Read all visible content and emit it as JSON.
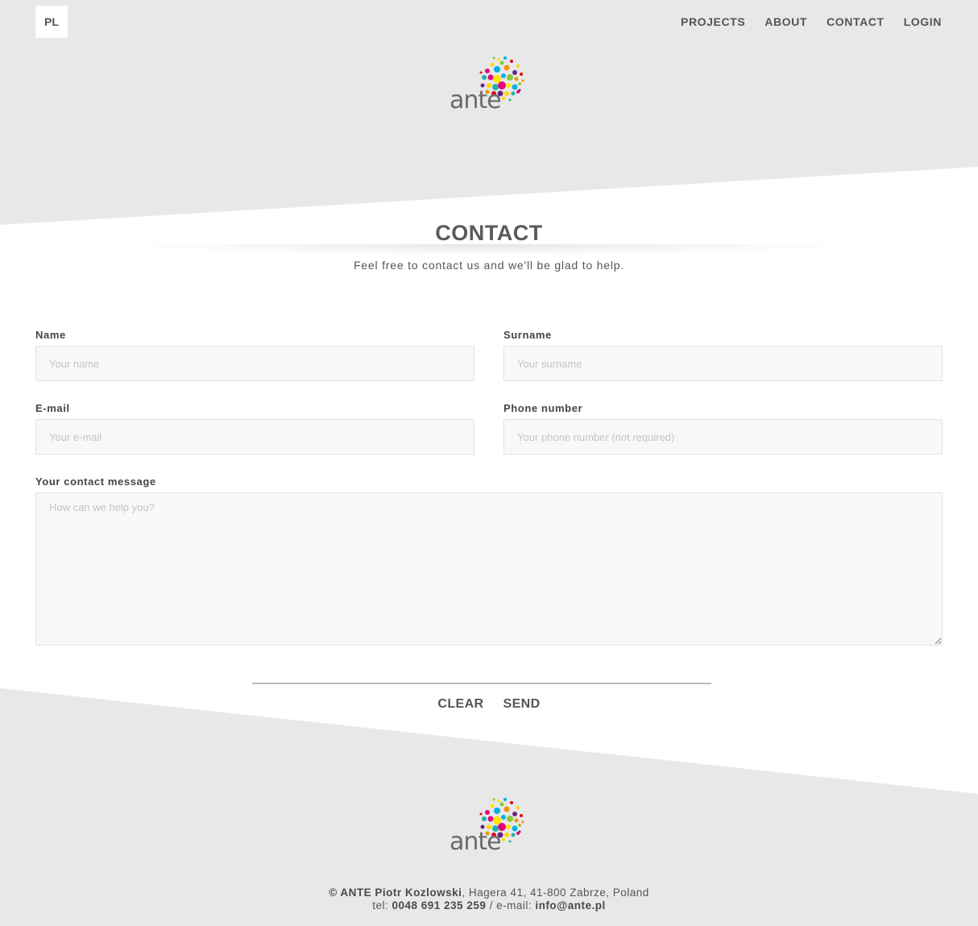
{
  "header": {
    "lang_button": "PL",
    "nav": [
      "PROJECTS",
      "ABOUT",
      "CONTACT",
      "LOGIN"
    ],
    "logo_text": "ante"
  },
  "main": {
    "title": "CONTACT",
    "subtitle": "Feel free to contact us and we'll be glad to help."
  },
  "form": {
    "name": {
      "label": "Name",
      "placeholder": "Your name"
    },
    "surname": {
      "label": "Surname",
      "placeholder": "Your surname"
    },
    "email": {
      "label": "E-mail",
      "placeholder": "Your e-mail"
    },
    "phone": {
      "label": "Phone number",
      "placeholder": "Your phone number (not required)"
    },
    "message": {
      "label": "Your contact message",
      "placeholder": "How can we help you?"
    },
    "clear_label": "CLEAR",
    "send_label": "SEND"
  },
  "footer": {
    "company": "© ANTE Piotr Kozlowski",
    "address": ", Hagera 41, 41-800 Zabrze, Poland",
    "tel_label": "tel: ",
    "tel": "0048 691 235 259",
    "email_label": " / e-mail: ",
    "email": "info@ante.pl",
    "logo_text": "ante"
  },
  "colors": {
    "band_gray": "#e8e8e8",
    "text": "#555555",
    "input_bg": "#f8f8f8"
  }
}
